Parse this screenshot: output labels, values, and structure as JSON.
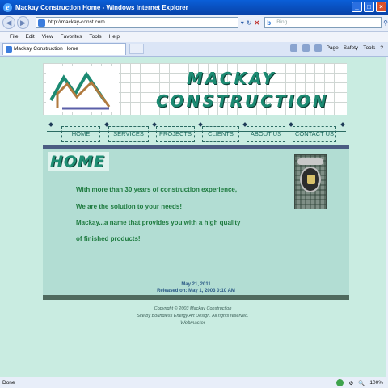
{
  "window": {
    "title": "Mackay Construction Home - Windows Internet Explorer"
  },
  "address_bar": {
    "url": "http://mackay-const.com",
    "search_placeholder": "Bing"
  },
  "menu": [
    "File",
    "Edit",
    "View",
    "Favorites",
    "Tools",
    "Help"
  ],
  "tab": {
    "label": "Mackay Construction Home"
  },
  "commands": {
    "page": "Page",
    "safety": "Safety",
    "tools": "Tools"
  },
  "site": {
    "brand_line1": "MACKAY",
    "brand_line2": "CONSTRUCTION",
    "nav": [
      "HOME",
      "SERVICES",
      "PROJECTS",
      "CLIENTS",
      "ABOUT US",
      "CONTACT US"
    ],
    "heading": "HOME",
    "lines": [
      "With more than 30 years of construction experience,",
      "We are the solution to your needs!",
      "Mackay...a name that provides you with a high quality",
      "of finished products!"
    ],
    "date": "May 21, 2011",
    "released": "Released on: May 1, 2003 0:10 AM",
    "footer": {
      "copyright": "Copyright © 2003 Mackay Construction",
      "credit": "Site by Boundless Energy Art Design. All rights reserved.",
      "webmaster": "Webmaster"
    }
  },
  "status": {
    "text": "Done",
    "zoom": "100%"
  },
  "colors": {
    "page_bg": "#c9ece1",
    "content_bg": "#b2ddd3",
    "brand_green": "#1c8a72",
    "text_green": "#1d7a3e",
    "ie_blue": "#0a5fd8"
  }
}
